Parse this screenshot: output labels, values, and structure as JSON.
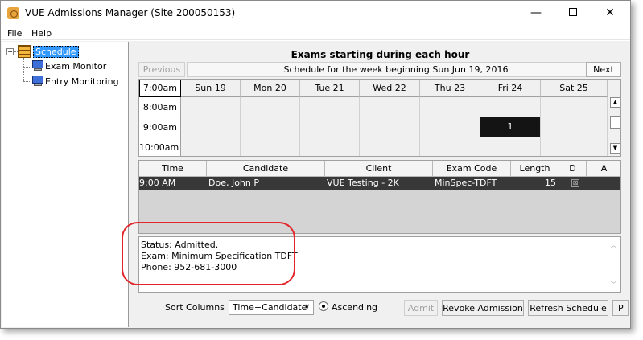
{
  "window": {
    "title": "VUE Admissions Manager (Site 200050153)",
    "minimize_glyph": "—",
    "close_glyph": "✕"
  },
  "menu": {
    "items": [
      "File",
      "Help"
    ]
  },
  "tree": {
    "toggle_glyph": "−",
    "root": "Schedule",
    "children": [
      "Exam Monitor",
      "Entry Monitoring"
    ]
  },
  "schedule": {
    "heading": "Exams starting during each hour",
    "previous_label": "Previous",
    "next_label": "Next",
    "week_label": "Schedule for the week beginning Sun Jun 19, 2016",
    "first_hour": "7:00am",
    "days": [
      "Sun 19",
      "Mon 20",
      "Tue 21",
      "Wed 22",
      "Thu 23",
      "Fri 24",
      "Sat 25"
    ],
    "hours": [
      "8:00am",
      "9:00am",
      "10:00am"
    ],
    "filled_cell": {
      "hour": "9:00am",
      "day": "Fri 24",
      "count": "1"
    },
    "scroll_up_glyph": "▲",
    "scroll_down_glyph": "▼"
  },
  "table": {
    "columns": [
      "Time",
      "Candidate",
      "Client",
      "Exam Code",
      "Length",
      "D",
      "A"
    ],
    "rows": [
      {
        "time": "9:00 AM",
        "candidate": "Doe, John P",
        "client": "VUE Testing - 2K",
        "exam_code": "MinSpec-TDFT",
        "length": "15",
        "d_glyph": "⊠"
      }
    ]
  },
  "status": {
    "lines": [
      "Status: Admitted.",
      "Exam: Minimum Specification TDFT",
      "Phone: 952-681-3000"
    ],
    "scroll_up_glyph": "︿",
    "scroll_down_glyph": "﹀"
  },
  "controls": {
    "sort_label": "Sort Columns",
    "sort_value": "Time+Candidate",
    "select_chevron": "∨",
    "ascending_label": "Ascending",
    "admit_label": "Admit",
    "revoke_label": "Revoke Admission",
    "refresh_label": "Refresh Schedule",
    "truncated_label": "P"
  },
  "colors": {
    "selection": "#3399ff",
    "row_selected": "#383838",
    "filled_cell": "#141414",
    "annotation": "#e3262b"
  }
}
